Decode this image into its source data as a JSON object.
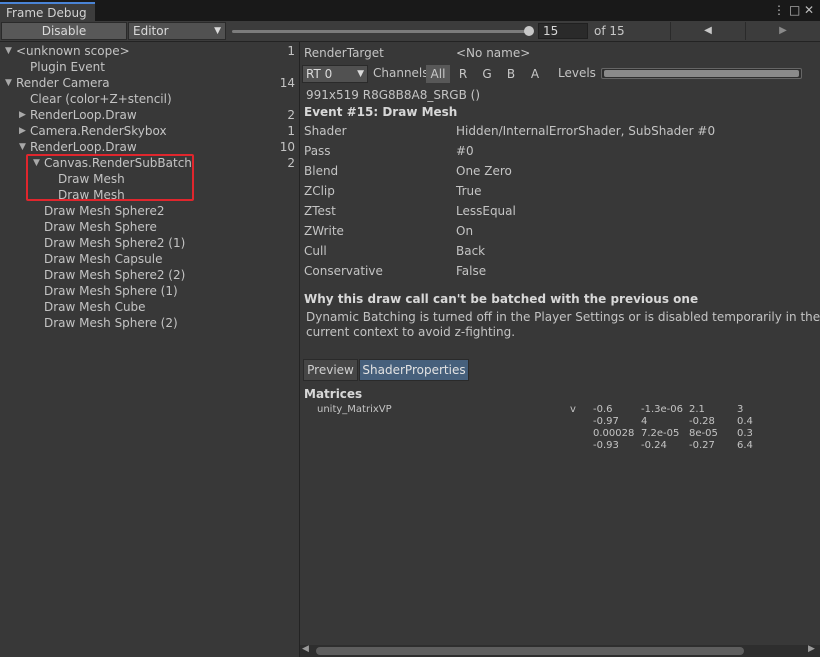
{
  "window": {
    "tab_title": "Frame Debug",
    "menu_icon": "⋮",
    "maximize_icon": "□",
    "close_icon": "✕"
  },
  "toolbar": {
    "disable_label": "Disable",
    "target_label": "Editor",
    "frame_value": "15",
    "frame_total": "of 15",
    "frame_total_count": 15,
    "prev_icon": "◀",
    "next_icon": "▶"
  },
  "tree": [
    {
      "label": "<unknown scope>",
      "count": "1",
      "arrow": "▼"
    },
    {
      "label": "Plugin Event",
      "count": "",
      "arrow": ""
    },
    {
      "label": "Render Camera",
      "count": "14",
      "arrow": "▼"
    },
    {
      "label": "Clear (color+Z+stencil)",
      "count": "",
      "arrow": ""
    },
    {
      "label": "RenderLoop.Draw",
      "count": "2",
      "arrow": "▶"
    },
    {
      "label": "Camera.RenderSkybox",
      "count": "1",
      "arrow": "▶"
    },
    {
      "label": "RenderLoop.Draw",
      "count": "10",
      "arrow": "▼"
    },
    {
      "label": "Canvas.RenderSubBatch",
      "count": "2",
      "arrow": "▼"
    },
    {
      "label": "Draw Mesh",
      "count": "",
      "arrow": ""
    },
    {
      "label": "Draw Mesh",
      "count": "",
      "arrow": ""
    },
    {
      "label": "Draw Mesh Sphere2",
      "count": "",
      "arrow": ""
    },
    {
      "label": "Draw Mesh Sphere",
      "count": "",
      "arrow": ""
    },
    {
      "label": "Draw Mesh Sphere2 (1)",
      "count": "",
      "arrow": ""
    },
    {
      "label": "Draw Mesh Capsule",
      "count": "",
      "arrow": ""
    },
    {
      "label": "Draw Mesh Sphere2 (2)",
      "count": "",
      "arrow": ""
    },
    {
      "label": "Draw Mesh Sphere (1)",
      "count": "",
      "arrow": ""
    },
    {
      "label": "Draw Mesh Cube",
      "count": "",
      "arrow": ""
    },
    {
      "label": "Draw Mesh Sphere (2)",
      "count": "",
      "arrow": ""
    }
  ],
  "detail": {
    "render_target_label": "RenderTarget",
    "render_target_value": "<No name>",
    "rt_select": "RT 0",
    "channels_label": "Channels",
    "channels": [
      "All",
      "R",
      "G",
      "B",
      "A"
    ],
    "levels_label": "Levels",
    "format": "991x519 R8G8B8A8_SRGB ()",
    "event_title": "Event #15: Draw Mesh",
    "properties": [
      {
        "key": "Shader",
        "value": "Hidden/InternalErrorShader, SubShader #0"
      },
      {
        "key": "Pass",
        "value": "#0"
      },
      {
        "key": "Blend",
        "value": "One Zero"
      },
      {
        "key": "ZClip",
        "value": "True"
      },
      {
        "key": "ZTest",
        "value": "LessEqual"
      },
      {
        "key": "ZWrite",
        "value": "On"
      },
      {
        "key": "Cull",
        "value": "Back"
      },
      {
        "key": "Conservative",
        "value": "False"
      }
    ],
    "batch_title": "Why this draw call can't be batched with the previous one",
    "batch_line1": "Dynamic Batching is turned off in the Player Settings or is disabled temporarily in the",
    "batch_line2": "current context to avoid z-fighting.",
    "tab_preview": "Preview",
    "tab_shader_properties": "ShaderProperties",
    "matrices_title": "Matrices",
    "matrix_name": "unity_MatrixVP",
    "matrix_stage": "v",
    "matrix_values": [
      [
        "-0.6",
        "-1.3e-06",
        "2.1",
        "3"
      ],
      [
        "-0.97",
        "4",
        "-0.28",
        "0.4"
      ],
      [
        "0.00028",
        "7.2e-05",
        "8e-05",
        "0.3"
      ],
      [
        "-0.93",
        "-0.24",
        "-0.27",
        "6.4"
      ]
    ]
  }
}
